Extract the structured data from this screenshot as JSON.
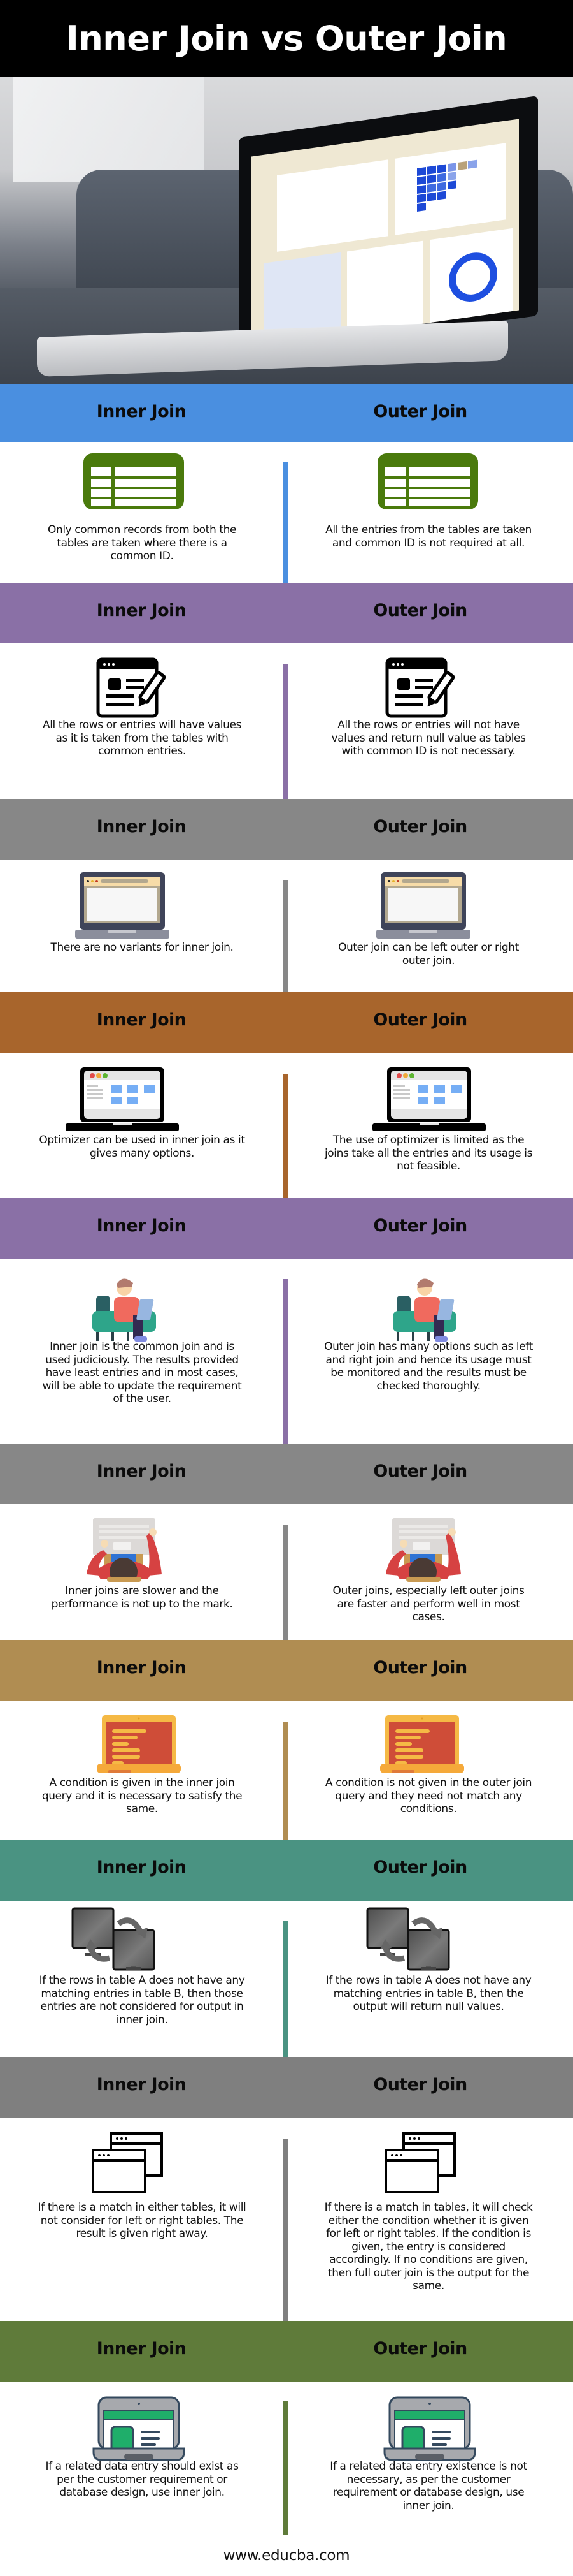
{
  "title": "Inner Join vs Outer Join",
  "hero": {
    "image": "laptop-analytics-dashboard-photo"
  },
  "column_labels": {
    "left": "Inner Join",
    "right": "Outer Join"
  },
  "colors": {
    "title_bar": "#000000",
    "sections": [
      "#4a8fe0",
      "#8a70a6",
      "#878787",
      "#a8652c",
      "#8a70a6",
      "#878787",
      "#b08d52",
      "#4a9382",
      "#7f7f7f",
      "#5f7b3a"
    ]
  },
  "sections": [
    {
      "icon": "spreadsheet-table-icon",
      "inner": "Only common records from both the tables are taken where there is a common ID.",
      "outer": "All the entries from the tables are taken and common ID is not required at all."
    },
    {
      "icon": "document-edit-icon",
      "inner": "All the rows or entries will have values as it is taken from the tables with common entries.",
      "outer": "All the rows or entries will not have values and return null value as tables with common ID is not necessary."
    },
    {
      "icon": "laptop-browser-icon",
      "inner": "There are no variants for inner join.",
      "outer": "Outer join can be left outer or right outer join."
    },
    {
      "icon": "laptop-dashboard-icon",
      "inner": "Optimizer can be used in inner join as it gives many options.",
      "outer": "The use of optimizer is limited as the joins take all the entries and its usage is not feasible."
    },
    {
      "icon": "person-on-laptop-icon",
      "inner": "Inner join is the common join and is used judiciously. The results provided have least entries and in most cases, will be able to update the requirement of the user.",
      "outer": "Outer join has many options such as left and right join and hence its usage must be monitored and the results must be checked thoroughly."
    },
    {
      "icon": "person-typing-topdown-icon",
      "inner": "Inner joins are slower and the performance is not up to the mark.",
      "outer": "Outer joins, especially left outer joins are faster and perform well in most cases."
    },
    {
      "icon": "laptop-code-icon",
      "inner": "A condition is given in the inner join query and it is necessary to satisfy the same.",
      "outer": "A condition is not given in the outer join query and they need not match any conditions."
    },
    {
      "icon": "monitors-sync-icon",
      "inner": "If the rows in table A does not have any matching entries in table B, then those entries are not considered for output in inner join.",
      "outer": "If the rows in table A does not have any matching entries in table B, then the output will return null values."
    },
    {
      "icon": "stacked-windows-icon",
      "inner": "If there is a match in either tables, it will not consider for left or right tables. The result is given right away.",
      "outer": "If there is a match in tables, it will check either the condition whether it is given for left or right tables. If the condition is given, the entry is considered accordingly. If no conditions are given, then full outer join is the output for the same."
    },
    {
      "icon": "laptop-profile-icon",
      "inner": "If a related data entry should exist as per the customer requirement or database design, use inner join.",
      "outer": "If a related data entry existence is not necessary, as per the customer requirement or database design, use inner join."
    }
  ],
  "footer": "www.educba.com"
}
